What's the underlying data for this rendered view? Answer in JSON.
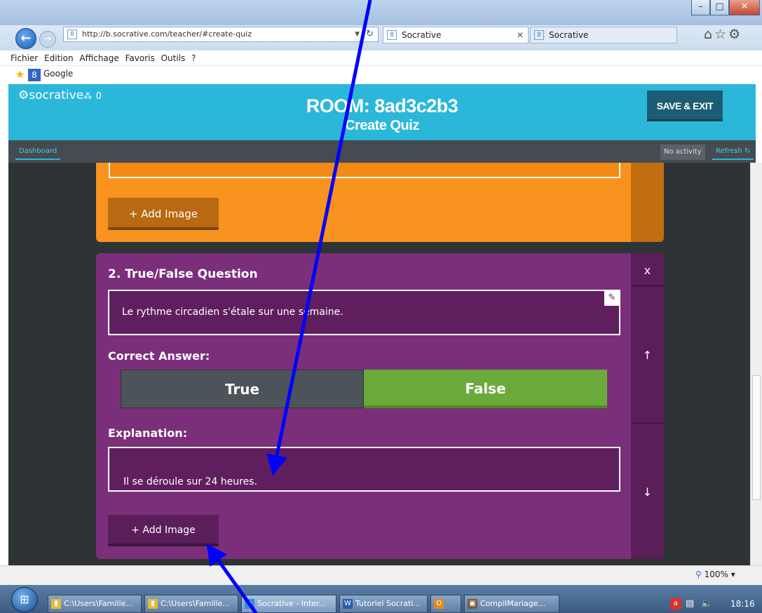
{
  "browser": {
    "url": "http://b.socrative.com/teacher/#create-quiz",
    "tabs": [
      {
        "label": "Socrative"
      },
      {
        "label": "Socrative"
      }
    ],
    "menu": [
      "Fichier",
      "Edition",
      "Affichage",
      "Favoris",
      "Outils",
      "?"
    ],
    "favorites": [
      {
        "label": "Google"
      }
    ],
    "zoom": "100%"
  },
  "app": {
    "logo": "socrative",
    "student_count": "0",
    "room": "ROOM: 8ad3c2b3",
    "subtitle": "Create Quiz",
    "save_exit": "SAVE & EXIT",
    "dashboard": "Dashboard",
    "no_activity": "No activity",
    "refresh": "Refresh"
  },
  "question1": {
    "add_image": "+ Add Image"
  },
  "question2": {
    "title": "2. True/False Question",
    "text": "Le rythme circadien s'étale sur une semaine.",
    "correct_answer_label": "Correct Answer:",
    "true_label": "True",
    "false_label": "False",
    "selected": "False",
    "explanation_label": "Explanation:",
    "explanation_text": "Il se déroule sur 24 heures.",
    "add_image": "+ Add Image",
    "delete": "x",
    "move_up": "↑",
    "move_down": "↓"
  },
  "taskbar": {
    "items": [
      {
        "label": "C:\\Users\\Famille..."
      },
      {
        "label": "C:\\Users\\Famille..."
      },
      {
        "label": "Socrative - Inter..."
      },
      {
        "label": "Tutoriel Socrati..."
      },
      {
        "label": ""
      },
      {
        "label": "CompilMariage..."
      }
    ],
    "time": "18:16"
  },
  "colors": {
    "header": "#2bb7d9",
    "question1": "#f7931e",
    "question2": "#7b2f7b",
    "false_selected": "#6aaa3a",
    "annotation_arrow": "#0000ff"
  }
}
